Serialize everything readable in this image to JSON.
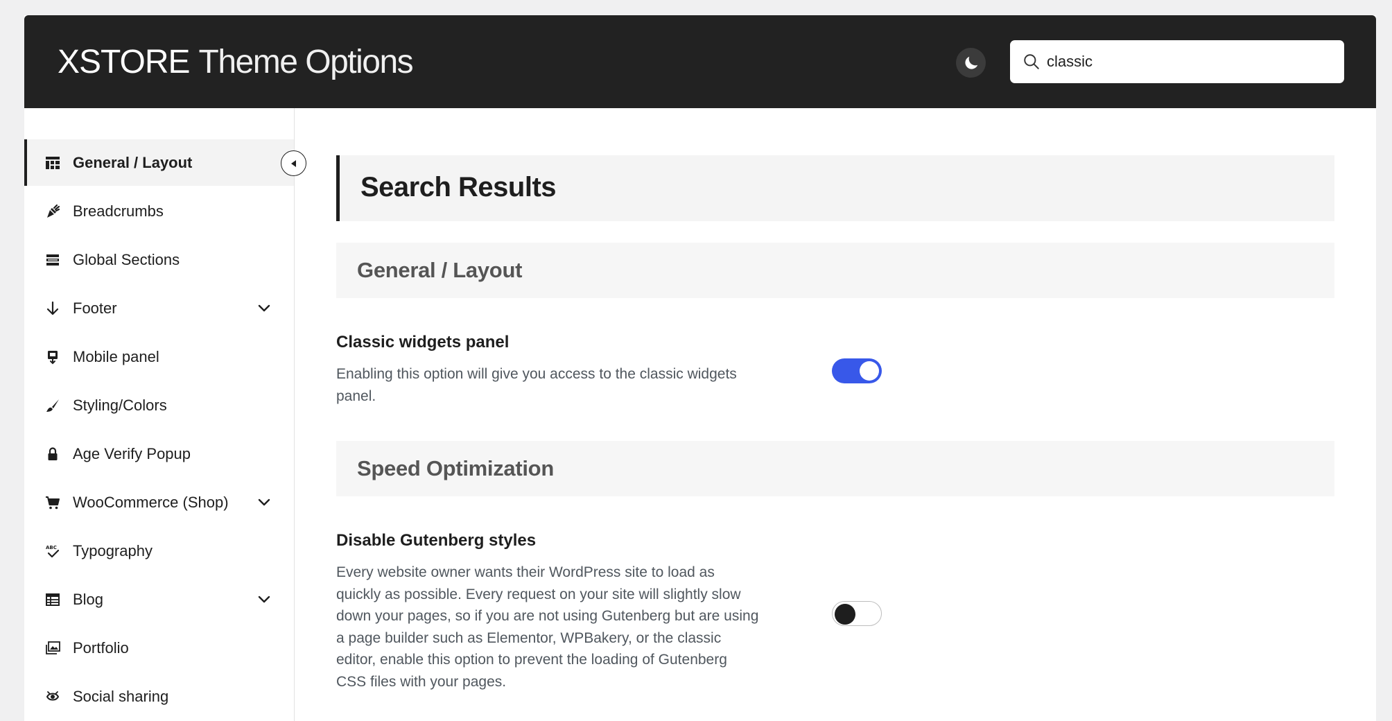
{
  "header": {
    "logo_brand": "XSTORE",
    "logo_title": "Theme Options",
    "search": {
      "value": "classic",
      "placeholder": ""
    }
  },
  "sidebar": {
    "items": [
      {
        "label": "General / Layout",
        "icon": "grid-layout-icon",
        "active": true,
        "expandable": false
      },
      {
        "label": "Breadcrumbs",
        "icon": "carrot-icon",
        "active": false,
        "expandable": false
      },
      {
        "label": "Global Sections",
        "icon": "sections-icon",
        "active": false,
        "expandable": false
      },
      {
        "label": "Footer",
        "icon": "arrow-down-icon",
        "active": false,
        "expandable": true
      },
      {
        "label": "Mobile panel",
        "icon": "mobile-panel-icon",
        "active": false,
        "expandable": false
      },
      {
        "label": "Styling/Colors",
        "icon": "brush-icon",
        "active": false,
        "expandable": false
      },
      {
        "label": "Age Verify Popup",
        "icon": "lock-icon",
        "active": false,
        "expandable": false
      },
      {
        "label": "WooCommerce (Shop)",
        "icon": "cart-icon",
        "active": false,
        "expandable": true
      },
      {
        "label": "Typography",
        "icon": "spellcheck-icon",
        "active": false,
        "expandable": false
      },
      {
        "label": "Blog",
        "icon": "table-icon",
        "active": false,
        "expandable": true
      },
      {
        "label": "Portfolio",
        "icon": "gallery-icon",
        "active": false,
        "expandable": false
      },
      {
        "label": "Social sharing",
        "icon": "share-icon",
        "active": false,
        "expandable": false
      }
    ]
  },
  "main": {
    "results_title": "Search Results",
    "sections": [
      {
        "heading": "General / Layout",
        "options": [
          {
            "title": "Classic widgets panel",
            "description": "Enabling this option will give you access to the classic widgets panel.",
            "enabled": true
          }
        ]
      },
      {
        "heading": "Speed Optimization",
        "options": [
          {
            "title": "Disable Gutenberg styles",
            "description": "Every website owner wants their WordPress site to load as quickly as possible. Every request on your site will slightly slow down your pages, so if you are not using Gutenberg but are using a page builder such as Elementor, WPBakery, or the classic editor, enable this option to prevent the loading of Gutenberg CSS files with your pages.",
            "enabled": false
          }
        ]
      }
    ]
  },
  "colors": {
    "header_bg": "#222222",
    "accent": "#3858e9",
    "toggle_off_knob": "#1e1e1e"
  }
}
